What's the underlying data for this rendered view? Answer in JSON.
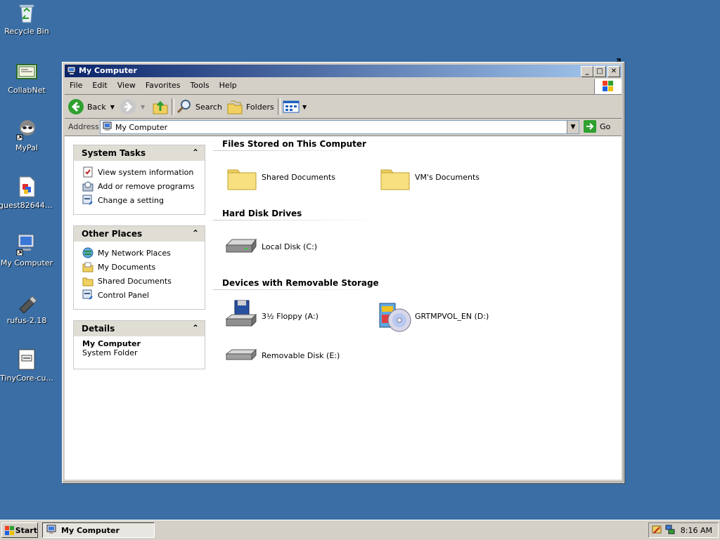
{
  "desktop": {
    "icons": [
      {
        "label": "Recycle Bin"
      },
      {
        "label": "CollabNet"
      },
      {
        "label": "MyPal"
      },
      {
        "label": "guest82644-..."
      },
      {
        "label": "My Computer"
      },
      {
        "label": "rufus-2.18"
      },
      {
        "label": "TinyCore-cu..."
      }
    ]
  },
  "window": {
    "title": "My Computer",
    "menu": [
      "File",
      "Edit",
      "View",
      "Favorites",
      "Tools",
      "Help"
    ],
    "toolbar": {
      "back": "Back",
      "search": "Search",
      "folders": "Folders"
    },
    "address": {
      "label": "Address",
      "value": "My Computer",
      "go": "Go"
    },
    "panels": {
      "system_tasks": {
        "title": "System Tasks",
        "links": [
          "View system information",
          "Add or remove programs",
          "Change a setting"
        ]
      },
      "other_places": {
        "title": "Other Places",
        "links": [
          "My Network Places",
          "My Documents",
          "Shared Documents",
          "Control Panel"
        ]
      },
      "details": {
        "title": "Details",
        "name": "My Computer",
        "type": "System Folder"
      }
    },
    "groups": {
      "files": {
        "title": "Files Stored on This Computer",
        "items": [
          "Shared Documents",
          "VM's Documents"
        ]
      },
      "hdd": {
        "title": "Hard Disk Drives",
        "items": [
          "Local Disk (C:)"
        ]
      },
      "removable": {
        "title": "Devices with Removable Storage",
        "items": [
          "3½ Floppy (A:)",
          "GRTMPVOL_EN (D:)",
          "Removable Disk (E:)"
        ]
      }
    }
  },
  "taskbar": {
    "start": "Start",
    "task": "My Computer",
    "clock": "8:16 AM"
  },
  "colors": {
    "desktop": "#3a6ea5",
    "titlebar_start": "#0a246a",
    "titlebar_end": "#a6caf0"
  }
}
